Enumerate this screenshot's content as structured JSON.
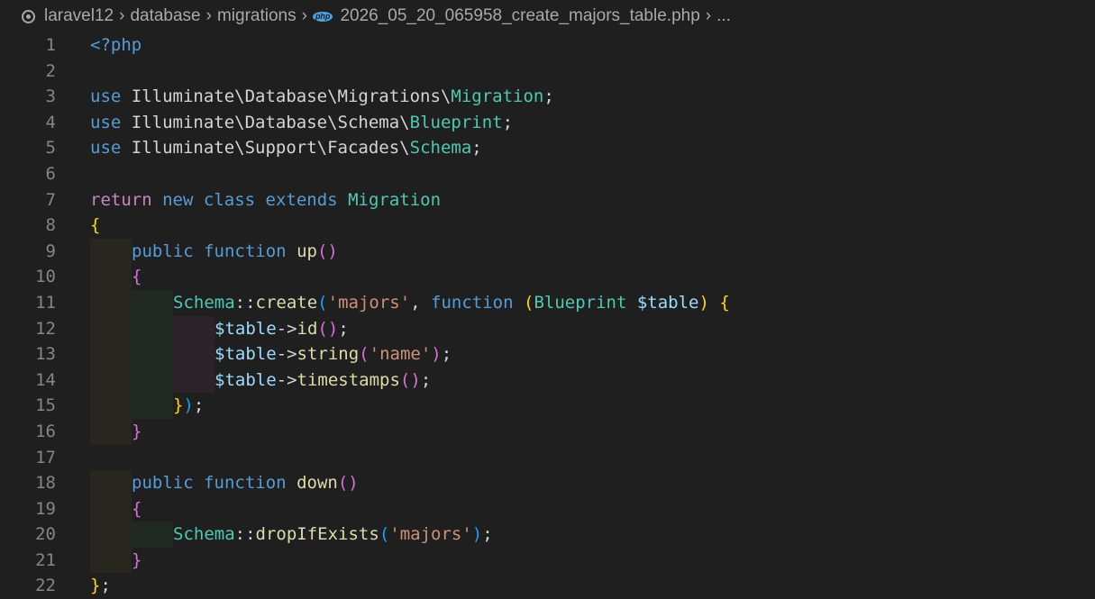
{
  "breadcrumb": {
    "items": [
      "laravel12",
      "database",
      "migrations",
      "2026_05_20_065958_create_majors_table.php",
      "..."
    ],
    "file_icon": "php"
  },
  "editor": {
    "lines": [
      {
        "n": "1",
        "tokens": [
          [
            "kw",
            "<?php"
          ]
        ]
      },
      {
        "n": "2",
        "tokens": []
      },
      {
        "n": "3",
        "tokens": [
          [
            "kw",
            "use"
          ],
          [
            "txt",
            " Illuminate\\Database\\Migrations\\"
          ],
          [
            "cls",
            "Migration"
          ],
          [
            "txt",
            ";"
          ]
        ]
      },
      {
        "n": "4",
        "tokens": [
          [
            "kw",
            "use"
          ],
          [
            "txt",
            " Illuminate\\Database\\Schema\\"
          ],
          [
            "cls",
            "Blueprint"
          ],
          [
            "txt",
            ";"
          ]
        ]
      },
      {
        "n": "5",
        "tokens": [
          [
            "kw",
            "use"
          ],
          [
            "txt",
            " Illuminate\\Support\\Facades\\"
          ],
          [
            "cls",
            "Schema"
          ],
          [
            "txt",
            ";"
          ]
        ]
      },
      {
        "n": "6",
        "tokens": []
      },
      {
        "n": "7",
        "tokens": [
          [
            "kc",
            "return"
          ],
          [
            "txt",
            " "
          ],
          [
            "kw",
            "new"
          ],
          [
            "txt",
            " "
          ],
          [
            "kw",
            "class"
          ],
          [
            "txt",
            " "
          ],
          [
            "kw",
            "extends"
          ],
          [
            "txt",
            " "
          ],
          [
            "cls",
            "Migration"
          ]
        ]
      },
      {
        "n": "8",
        "tokens": [
          [
            "p1",
            "{"
          ]
        ]
      },
      {
        "n": "9",
        "indent": 1,
        "tokens": [
          [
            "kw",
            "public"
          ],
          [
            "txt",
            " "
          ],
          [
            "kw",
            "function"
          ],
          [
            "txt",
            " "
          ],
          [
            "fn",
            "up"
          ],
          [
            "p2",
            "()"
          ]
        ]
      },
      {
        "n": "10",
        "indent": 1,
        "tokens": [
          [
            "p2",
            "{"
          ]
        ]
      },
      {
        "n": "11",
        "indent": 2,
        "tokens": [
          [
            "cls",
            "Schema"
          ],
          [
            "txt",
            "::"
          ],
          [
            "fn",
            "create"
          ],
          [
            "p3",
            "("
          ],
          [
            "str",
            "'majors'"
          ],
          [
            "txt",
            ", "
          ],
          [
            "kw",
            "function"
          ],
          [
            "txt",
            " "
          ],
          [
            "p1",
            "("
          ],
          [
            "cls",
            "Blueprint"
          ],
          [
            "txt",
            " "
          ],
          [
            "var",
            "$table"
          ],
          [
            "p1",
            ")"
          ],
          [
            "txt",
            " "
          ],
          [
            "p1",
            "{"
          ]
        ]
      },
      {
        "n": "12",
        "indent": 3,
        "tokens": [
          [
            "var",
            "$table"
          ],
          [
            "txt",
            "->"
          ],
          [
            "fn",
            "id"
          ],
          [
            "p2",
            "()"
          ],
          [
            "txt",
            ";"
          ]
        ]
      },
      {
        "n": "13",
        "indent": 3,
        "tokens": [
          [
            "var",
            "$table"
          ],
          [
            "txt",
            "->"
          ],
          [
            "fn",
            "string"
          ],
          [
            "p2",
            "("
          ],
          [
            "str",
            "'name'"
          ],
          [
            "p2",
            ")"
          ],
          [
            "txt",
            ";"
          ]
        ]
      },
      {
        "n": "14",
        "indent": 3,
        "tokens": [
          [
            "var",
            "$table"
          ],
          [
            "txt",
            "->"
          ],
          [
            "fn",
            "timestamps"
          ],
          [
            "p2",
            "()"
          ],
          [
            "txt",
            ";"
          ]
        ]
      },
      {
        "n": "15",
        "indent": 2,
        "tokens": [
          [
            "p1",
            "}"
          ],
          [
            "p3",
            ")"
          ],
          [
            "txt",
            ";"
          ]
        ]
      },
      {
        "n": "16",
        "indent": 1,
        "tokens": [
          [
            "p2",
            "}"
          ]
        ]
      },
      {
        "n": "17",
        "tokens": []
      },
      {
        "n": "18",
        "indent": 1,
        "tokens": [
          [
            "kw",
            "public"
          ],
          [
            "txt",
            " "
          ],
          [
            "kw",
            "function"
          ],
          [
            "txt",
            " "
          ],
          [
            "fn",
            "down"
          ],
          [
            "p2",
            "()"
          ]
        ]
      },
      {
        "n": "19",
        "indent": 1,
        "tokens": [
          [
            "p2",
            "{"
          ]
        ]
      },
      {
        "n": "20",
        "indent": 2,
        "tokens": [
          [
            "cls",
            "Schema"
          ],
          [
            "txt",
            "::"
          ],
          [
            "fn",
            "dropIfExists"
          ],
          [
            "p3",
            "("
          ],
          [
            "str",
            "'majors'"
          ],
          [
            "p3",
            ")"
          ],
          [
            "txt",
            ";"
          ]
        ]
      },
      {
        "n": "21",
        "indent": 1,
        "tokens": [
          [
            "p2",
            "}"
          ]
        ]
      },
      {
        "n": "22",
        "tokens": [
          [
            "p1",
            "}"
          ],
          [
            "txt",
            ";"
          ]
        ]
      }
    ]
  }
}
